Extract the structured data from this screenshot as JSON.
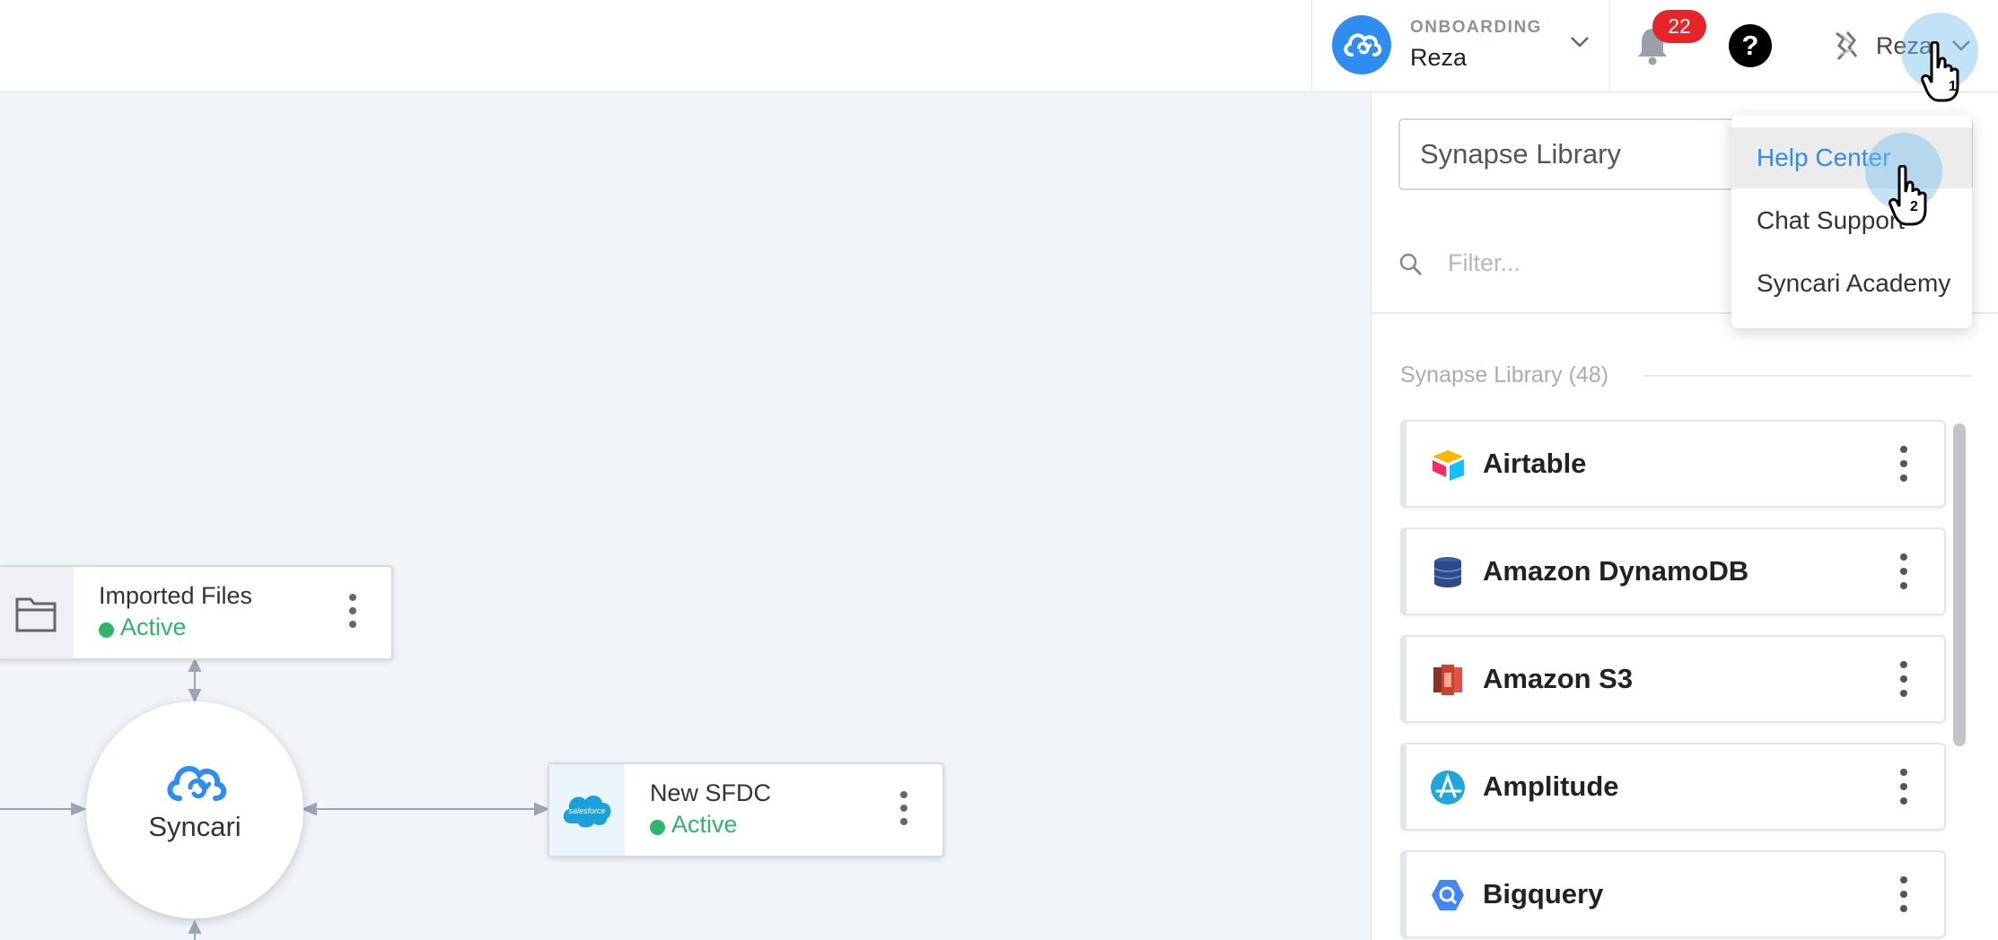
{
  "header": {
    "workspace_label": "ONBOARDING",
    "workspace_name": "Reza",
    "notification_count": "22",
    "help_glyph": "?",
    "user_name": "Reza"
  },
  "user_menu": {
    "items": [
      "Help Center",
      "Chat Support",
      "Syncari Academy"
    ],
    "active_index": 0
  },
  "click_markers": [
    "1",
    "2"
  ],
  "canvas": {
    "nodes": [
      {
        "title": "Imported Files",
        "status": "Active",
        "icon": "folder-icon"
      },
      {
        "title": "New SFDC",
        "status": "Active",
        "icon": "salesforce-icon",
        "icon_text": "salesforce"
      }
    ],
    "hub_label": "Syncari"
  },
  "panel": {
    "select_value": "Synapse Library",
    "filter_placeholder": "Filter...",
    "library_header": "Synapse Library (48)",
    "library_items": [
      {
        "label": "Airtable",
        "icon": "airtable-icon"
      },
      {
        "label": "Amazon DynamoDB",
        "icon": "dynamodb-icon"
      },
      {
        "label": "Amazon S3",
        "icon": "s3-icon"
      },
      {
        "label": "Amplitude",
        "icon": "amplitude-icon"
      },
      {
        "label": "Bigquery",
        "icon": "bigquery-icon"
      }
    ]
  },
  "colors": {
    "brand_blue": "#2f8cf0",
    "active_green": "#2fb56a",
    "badge_red": "#e8242b"
  }
}
